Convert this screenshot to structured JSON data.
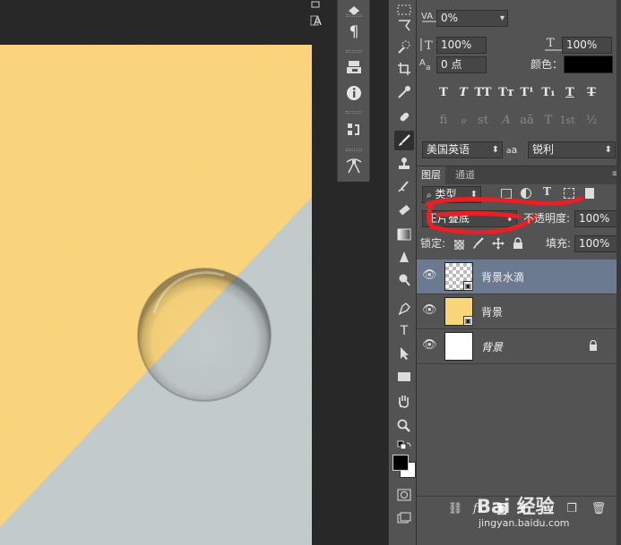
{
  "colors": {
    "paper_yellow": "#fbd57a",
    "paper_gray": "#c2cbcb",
    "workspace": "#282828",
    "panel": "#535353",
    "selection": "#6b7a90",
    "annotation_red": "#e81f24"
  },
  "mini_toolbar": {
    "icons": [
      "character-style-icon",
      "paragraph-icon",
      "stamp-preset-icon",
      "info-icon",
      "history-icon",
      "path-icon"
    ],
    "paragraph_glyph": "¶",
    "info_glyph": "ℹ"
  },
  "tools": {
    "icons": [
      "marquee-tool-icon",
      "lasso-tool-icon",
      "quick-selection-tool-icon",
      "crop-tool-icon",
      "eyedropper-tool-icon",
      "healing-brush-tool-icon",
      "brush-tool-icon",
      "clone-stamp-tool-icon",
      "history-brush-tool-icon",
      "eraser-tool-icon",
      "gradient-tool-icon",
      "blur-tool-icon",
      "dodge-tool-icon",
      "pen-tool-icon",
      "type-tool-icon",
      "path-selection-tool-icon",
      "rectangle-tool-icon",
      "hand-tool-icon",
      "zoom-tool-icon"
    ],
    "active": "brush-tool-icon",
    "type_glyph": "T"
  },
  "character": {
    "tracking_value": "0%",
    "vertical_scale_value": "100%",
    "horizontal_scale_value": "100%",
    "baseline_shift_value": "0 点",
    "color_label": "颜色：",
    "language_value": "美国英语",
    "aa_label": "a",
    "antialias_value": "锐利",
    "style_buttons": [
      "T",
      "T",
      "TT",
      "Tт",
      "T¹",
      "T₁",
      "T",
      "T"
    ],
    "opentype_buttons": [
      "fi",
      "ℴ",
      "st",
      "A",
      "aā",
      "T",
      "1st",
      "½"
    ]
  },
  "layers": {
    "tabs": [
      "图层",
      "通道"
    ],
    "kind_filter": "类型",
    "blend_mode": "正片叠底",
    "opacity_label": "不透明度:",
    "opacity_value": "100%",
    "lock_label": "锁定:",
    "fill_label": "填充:",
    "fill_value": "100%",
    "items": [
      {
        "name": "背景水滴",
        "selected": true
      },
      {
        "name": "背景",
        "selected": false
      },
      {
        "name": "背景",
        "selected": false
      }
    ]
  },
  "watermark": {
    "brand": "Bai 经验",
    "url": "jingyan.baidu.com"
  }
}
